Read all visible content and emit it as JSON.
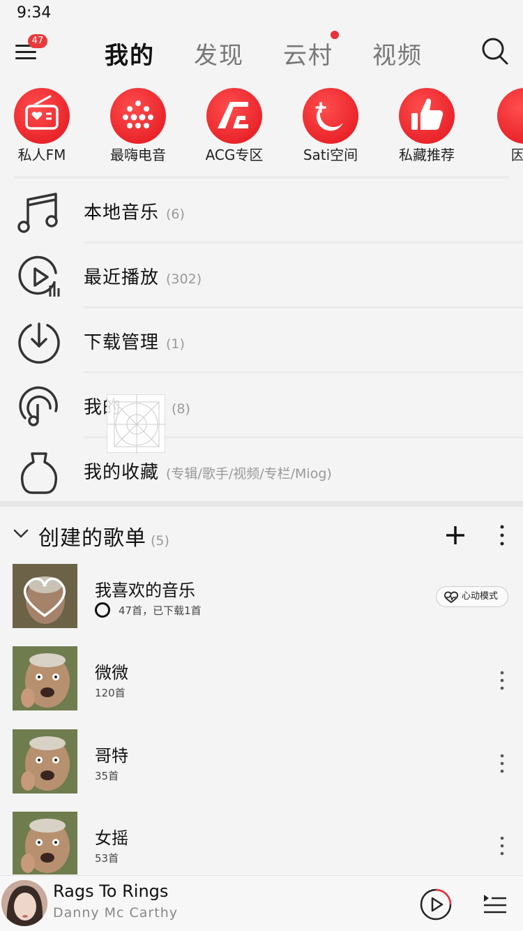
{
  "status_bar": {
    "time": "9:34"
  },
  "nav": {
    "menu_badge": "47",
    "tabs": [
      {
        "label": "我的",
        "active": true
      },
      {
        "label": "发现",
        "active": false
      },
      {
        "label": "云村",
        "active": false,
        "dot": true
      },
      {
        "label": "视频",
        "active": false
      }
    ],
    "search_icon": "search-icon"
  },
  "shortcuts": [
    {
      "label": "私人FM",
      "icon": "radio-icon"
    },
    {
      "label": "最嗨电音",
      "icon": "dots-grid-icon"
    },
    {
      "label": "ACG专区",
      "icon": "acg-icon"
    },
    {
      "label": "Sati空间",
      "icon": "moon-icon"
    },
    {
      "label": "私藏推荐",
      "icon": "thumbs-up-icon"
    },
    {
      "label": "因乐",
      "icon": "music-icon"
    }
  ],
  "menu": [
    {
      "label": "本地音乐",
      "count": "(6)",
      "icon": "music-note-icon"
    },
    {
      "label": "最近播放",
      "count": "(302)",
      "icon": "recent-play-icon"
    },
    {
      "label": "下载管理",
      "count": "(1)",
      "icon": "download-icon"
    },
    {
      "label": "我的",
      "count": "(8)",
      "icon": "podcast-icon"
    },
    {
      "label": "我的收藏",
      "count": "(专辑/歌手/视频/专栏/Miog)",
      "icon": "vase-icon"
    }
  ],
  "playlists_section": {
    "title": "创建的歌单",
    "count": "(5)"
  },
  "playlists": [
    {
      "name": "我喜欢的音乐",
      "sub": "47首，已下载1首",
      "heart_mode": "心动模式",
      "liked": true
    },
    {
      "name": "微微",
      "sub": "120首"
    },
    {
      "name": "哥特",
      "sub": "35首"
    },
    {
      "name": "女摇",
      "sub": "53首"
    }
  ],
  "player": {
    "title": "Rags To Rings",
    "artist": "Danny Mc Carthy"
  },
  "colors": {
    "accent": "#e8313a",
    "background": "#f4f4f4"
  }
}
